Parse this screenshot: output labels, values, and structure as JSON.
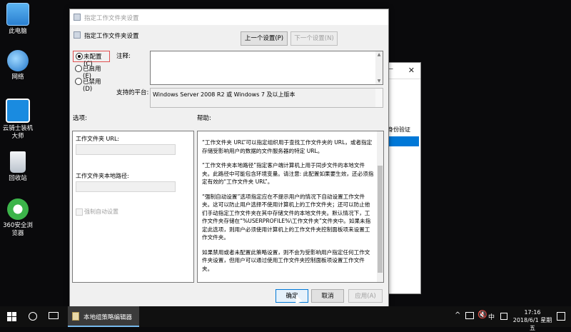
{
  "desktop": {
    "icons": [
      {
        "label": "此电脑",
        "icon": "computer-icon"
      },
      {
        "label": "网络",
        "icon": "network-icon"
      },
      {
        "label": "云骑士装机大师",
        "icon": "yunqishi-icon"
      },
      {
        "label": "回收站",
        "icon": "recycle-bin-icon"
      },
      {
        "label": "360安全浏览器",
        "icon": "browser-360-icon"
      }
    ]
  },
  "bg_window": {
    "row1": "身份验证"
  },
  "dialog": {
    "window_title": "指定工作文件夹设置",
    "header_title": "指定工作文件夹设置",
    "prev_button": "上一个设置(P)",
    "next_button": "下一个设置(N)",
    "radio_not_configured": "未配置(C)",
    "radio_enabled": "已启用(E)",
    "radio_disabled": "已禁用(D)",
    "comment_label": "注释:",
    "platform_label": "支持的平台:",
    "platform_value": "Windows Server 2008 R2 或 Windows 7 及以上版本",
    "options_label": "选项:",
    "help_label": "帮助:",
    "url_label": "工作文件夹 URL:",
    "local_path_label": "工作文件夹本地路径:",
    "force_auto_label": "强制自动设置",
    "help_paragraphs": [
      "“工作文件夹 URL”可以指定组织用于查找工作文件夹的 URL，或者指定存储受影响用户的数据的文件服务器的特定 URL。",
      "“工作文件夹本地路径”指定客户端计算机上用于同步文件的本地文件夹。此路径中可能包含环境变量。请注意: 此配置如果要生效，还必须指定有效的“工作文件夹 URL”。",
      "“强制自动设置”选项指定应在不提示用户的情况下自动设置工作文件夹。这可以防止用户选择不使用计算机上的工作文件夹；还可以防止他们手动指定工作文件夹在其中存储文件的本地文件夹。默认情况下，工作文件夹存储在“%USERPROFILE%\\工作文件夹”文件夹中。如果未指定此选项，则用户必须使用计算机上的工作文件夹控制面板项来设置工作文件夹。",
      "如果禁用或者未配置此策略设置，则不会为受影响用户指定任何工作文件夹设置，但用户可以通过使用工作文件夹控制面板项设置工作文件夹。"
    ],
    "ok_button": "确定",
    "cancel_button": "取消",
    "apply_button": "应用(A)"
  },
  "taskbar": {
    "active_app": "本地组策略编辑器",
    "ime": "中",
    "time": "17:16",
    "date": "2018/6/1 星期五"
  }
}
